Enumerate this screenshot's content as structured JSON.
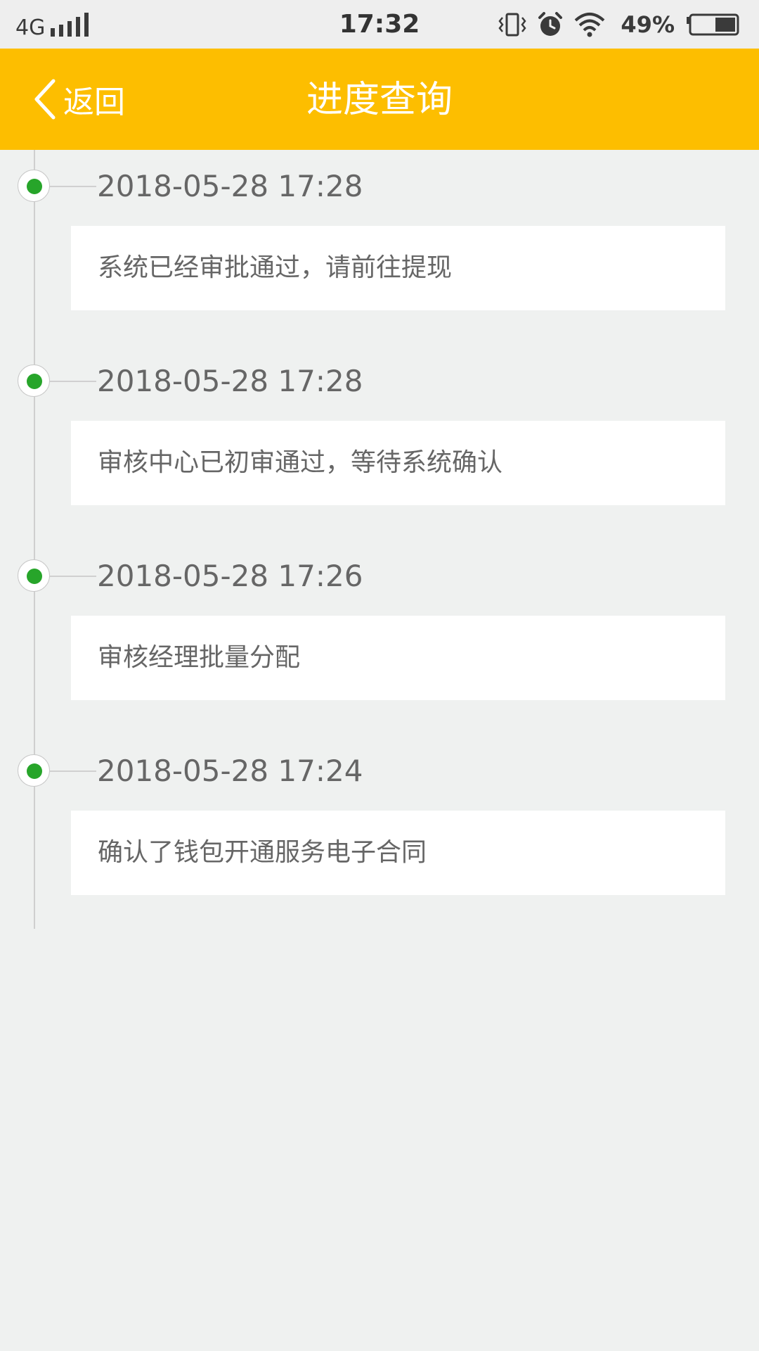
{
  "status_bar": {
    "network": "4G",
    "time": "17:32",
    "battery": "49%"
  },
  "nav": {
    "back_label": "返回",
    "title": "进度查询"
  },
  "colors": {
    "accent": "#fdbe00",
    "status_dot": "#27a52a",
    "background": "#eff1f0"
  },
  "events": [
    {
      "time": "2018-05-28 17:28",
      "text": "系统已经审批通过，请前往提现"
    },
    {
      "time": "2018-05-28 17:28",
      "text": "审核中心已初审通过，等待系统确认"
    },
    {
      "time": "2018-05-28 17:26",
      "text": "审核经理批量分配"
    },
    {
      "time": "2018-05-28 17:24",
      "text": "确认了钱包开通服务电子合同"
    }
  ]
}
